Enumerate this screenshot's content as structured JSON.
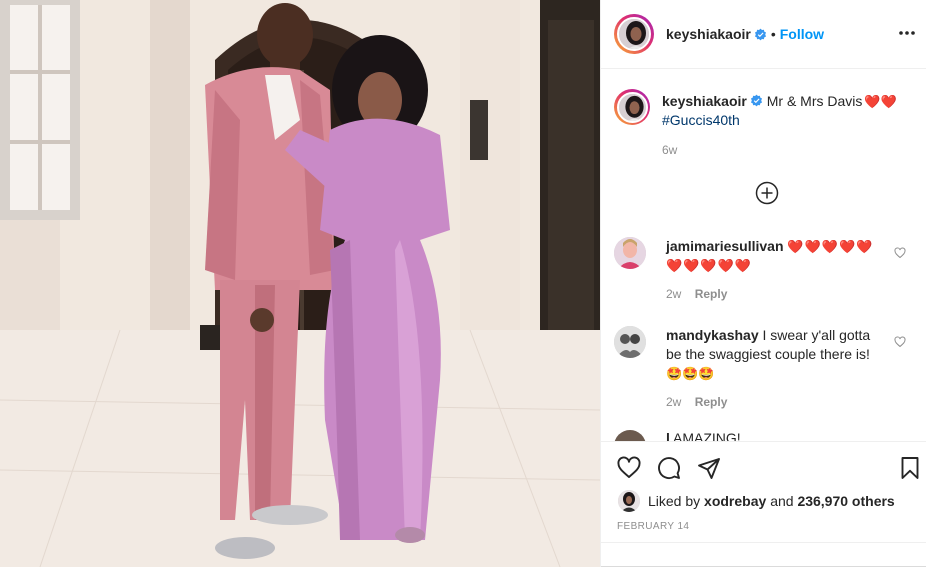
{
  "post": {
    "author": "keyshiakaoir",
    "follow_label": "Follow",
    "separator": "•"
  },
  "caption": {
    "username": "keyshiakaoir",
    "text": "Mr & Mrs Davis",
    "hashtag": "#Guccis40th",
    "time": "6w"
  },
  "comments": [
    {
      "username": "jamimariesullivan",
      "text": "",
      "emoji": "❤️❤️❤️❤️❤️❤️❤️❤️❤️❤️",
      "time": "2w",
      "reply_label": "Reply"
    },
    {
      "username": "mandykashay",
      "text": "I swear y'all gotta be the swaggiest couple there is!",
      "emoji": "🤩🤩🤩",
      "time": "2w",
      "reply_label": "Reply"
    },
    {
      "username": "l",
      "text": "AMAZING!"
    }
  ],
  "likes": {
    "prefix": "Liked by",
    "user": "xodrebay",
    "middle": "and",
    "count": "236,970 others"
  },
  "date": "FEBRUARY 14",
  "icons": {
    "like": "heart-outline-icon",
    "comment": "comment-bubble-icon",
    "share": "paper-plane-icon",
    "save": "bookmark-icon",
    "more": "more-dots-icon",
    "load_more": "plus-circle-icon"
  },
  "colors": {
    "link_blue": "#0095f6",
    "hashtag": "#00376b",
    "gray": "#8e8e8e",
    "heart_red": "#ed4956"
  }
}
